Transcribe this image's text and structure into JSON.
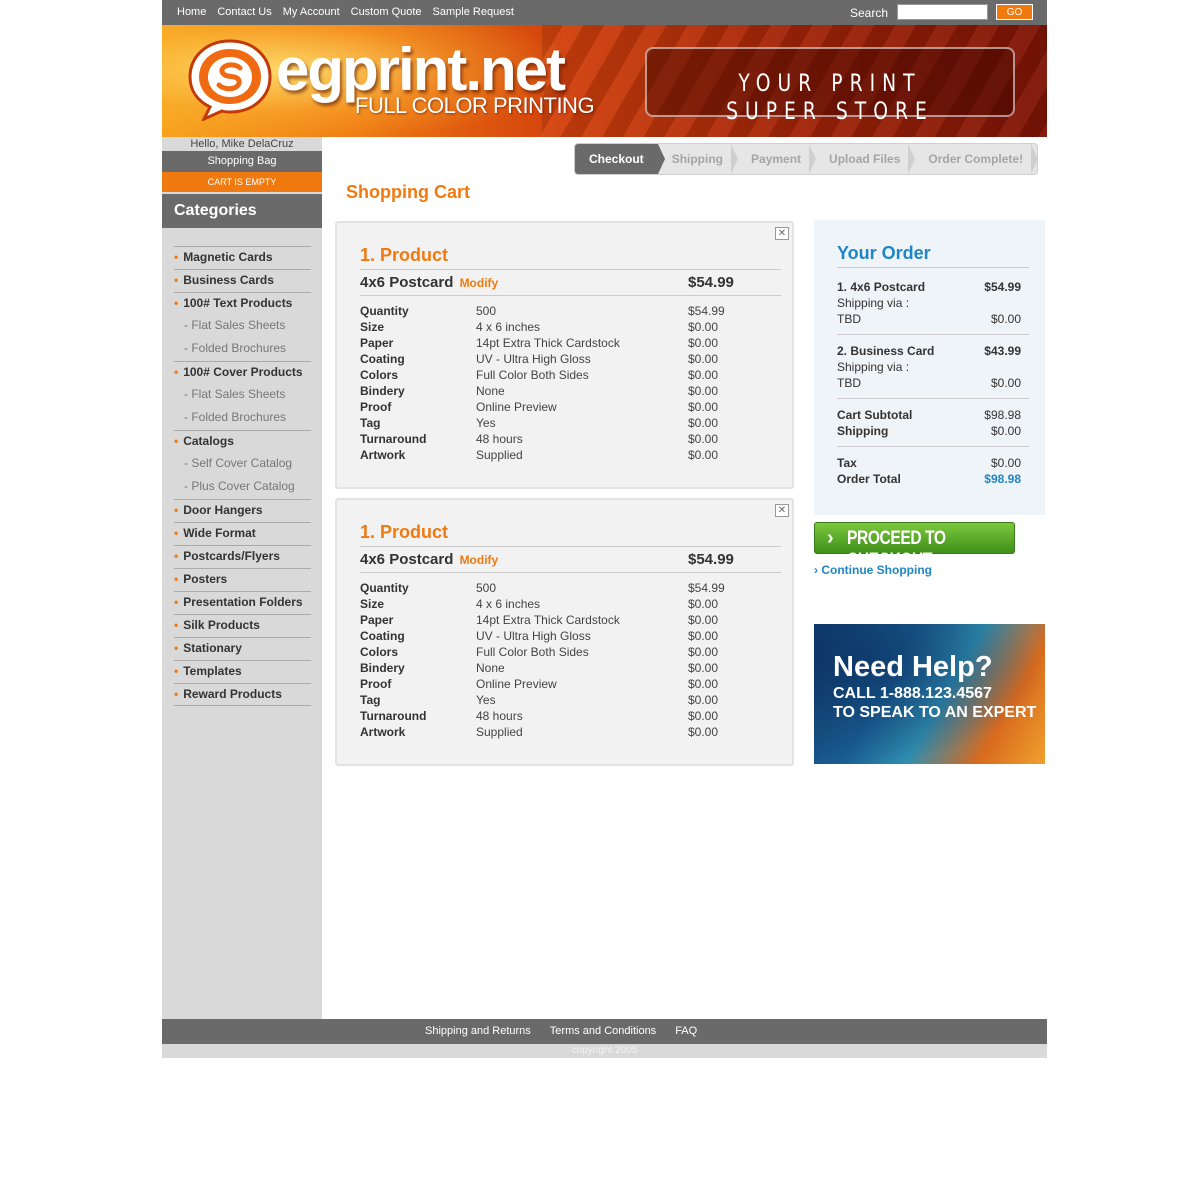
{
  "top_nav": [
    "Home",
    "Contact Us",
    "My Account",
    "Custom Quote",
    "Sample Request"
  ],
  "search": {
    "label": "Search",
    "placeholder": "",
    "button": "GO"
  },
  "brand": {
    "name": "egprint.net",
    "subtitle": "FULL COLOR PRINTING",
    "tagline": "YOUR PRINT SUPER STORE",
    "accent": "#f07a10"
  },
  "sidebar": {
    "greeting": "Hello, Mike DelaCruz",
    "bag_label": "Shopping Bag",
    "cart_status": "CART IS EMPTY",
    "categories_title": "Categories",
    "items": [
      {
        "label": "Magnetic Cards",
        "type": "main"
      },
      {
        "label": "Business Cards",
        "type": "main"
      },
      {
        "label": "100# Text Products",
        "type": "main"
      },
      {
        "label": "- Flat Sales Sheets",
        "type": "sub"
      },
      {
        "label": "- Folded Brochures",
        "type": "sub"
      },
      {
        "label": "100# Cover Products",
        "type": "main"
      },
      {
        "label": "- Flat Sales Sheets",
        "type": "sub"
      },
      {
        "label": "- Folded Brochures",
        "type": "sub"
      },
      {
        "label": "Catalogs",
        "type": "main"
      },
      {
        "label": "- Self Cover Catalog",
        "type": "sub"
      },
      {
        "label": "- Plus Cover Catalog",
        "type": "sub"
      },
      {
        "label": "Door Hangers",
        "type": "main"
      },
      {
        "label": "Wide Format",
        "type": "main"
      },
      {
        "label": "Postcards/Flyers",
        "type": "main"
      },
      {
        "label": "Posters",
        "type": "main"
      },
      {
        "label": "Presentation Folders",
        "type": "main"
      },
      {
        "label": "Silk Products",
        "type": "main"
      },
      {
        "label": "Stationary",
        "type": "main"
      },
      {
        "label": "Templates",
        "type": "main"
      },
      {
        "label": "Reward Products",
        "type": "main"
      }
    ]
  },
  "steps": [
    {
      "label": "Checkout",
      "active": true
    },
    {
      "label": "Shipping",
      "active": false
    },
    {
      "label": "Payment",
      "active": false
    },
    {
      "label": "Upload Files",
      "active": false
    },
    {
      "label": "Order Complete!",
      "active": false
    }
  ],
  "cart": {
    "title": "Shopping Cart",
    "products": [
      {
        "heading": "1. Product",
        "name": "4x6 Postcard",
        "modify_label": "Modify",
        "price": "$54.99",
        "specs": [
          {
            "key": "Quantity",
            "value": "500",
            "price": "$54.99"
          },
          {
            "key": "Size",
            "value": "4 x 6 inches",
            "price": "$0.00"
          },
          {
            "key": "Paper",
            "value": "14pt Extra Thick Cardstock",
            "price": "$0.00"
          },
          {
            "key": "Coating",
            "value": "UV - Ultra High Gloss",
            "price": "$0.00"
          },
          {
            "key": "Colors",
            "value": "Full Color Both Sides",
            "price": "$0.00"
          },
          {
            "key": "Bindery",
            "value": "None",
            "price": "$0.00"
          },
          {
            "key": "Proof",
            "value": "Online Preview",
            "price": "$0.00"
          },
          {
            "key": "Tag",
            "value": "Yes",
            "price": "$0.00"
          },
          {
            "key": "Turnaround",
            "value": "48 hours",
            "price": "$0.00"
          },
          {
            "key": "Artwork",
            "value": "Supplied",
            "price": "$0.00"
          }
        ]
      },
      {
        "heading": "1. Product",
        "name": "4x6 Postcard",
        "modify_label": "Modify",
        "price": "$54.99",
        "specs": [
          {
            "key": "Quantity",
            "value": "500",
            "price": "$54.99"
          },
          {
            "key": "Size",
            "value": "4 x 6 inches",
            "price": "$0.00"
          },
          {
            "key": "Paper",
            "value": "14pt Extra Thick Cardstock",
            "price": "$0.00"
          },
          {
            "key": "Coating",
            "value": "UV - Ultra High Gloss",
            "price": "$0.00"
          },
          {
            "key": "Colors",
            "value": "Full Color Both Sides",
            "price": "$0.00"
          },
          {
            "key": "Bindery",
            "value": "None",
            "price": "$0.00"
          },
          {
            "key": "Proof",
            "value": "Online Preview",
            "price": "$0.00"
          },
          {
            "key": "Tag",
            "value": "Yes",
            "price": "$0.00"
          },
          {
            "key": "Turnaround",
            "value": "48 hours",
            "price": "$0.00"
          },
          {
            "key": "Artwork",
            "value": "Supplied",
            "price": "$0.00"
          }
        ]
      }
    ]
  },
  "order": {
    "title": "Your Order",
    "items": [
      {
        "name": "1. 4x6 Postcard",
        "price": "$54.99",
        "shipping_label": "Shipping via :",
        "shipping_method": "TBD",
        "shipping_price": "$0.00"
      },
      {
        "name": "2.  Business Card",
        "price": "$43.99",
        "shipping_label": "Shipping via :",
        "shipping_method": "TBD",
        "shipping_price": "$0.00"
      }
    ],
    "subtotal_label": "Cart Subtotal",
    "subtotal": "$98.98",
    "shipping_label": "Shipping",
    "shipping": "$0.00",
    "tax_label": "Tax",
    "tax": "$0.00",
    "total_label": "Order Total",
    "total": "$98.98",
    "total_color": "#1f86c5"
  },
  "checkout_button": "PROCEED TO CHECKOUT",
  "continue_label": "Continue Shopping",
  "help": {
    "heading": "Need Help?",
    "line1": "CALL 1-888.123.4567",
    "line2": "TO SPEAK TO AN EXPERT"
  },
  "footer": {
    "links": [
      "Shipping and Returns",
      "Terms and Conditions",
      "FAQ"
    ],
    "copyright": "copyright 2005"
  }
}
